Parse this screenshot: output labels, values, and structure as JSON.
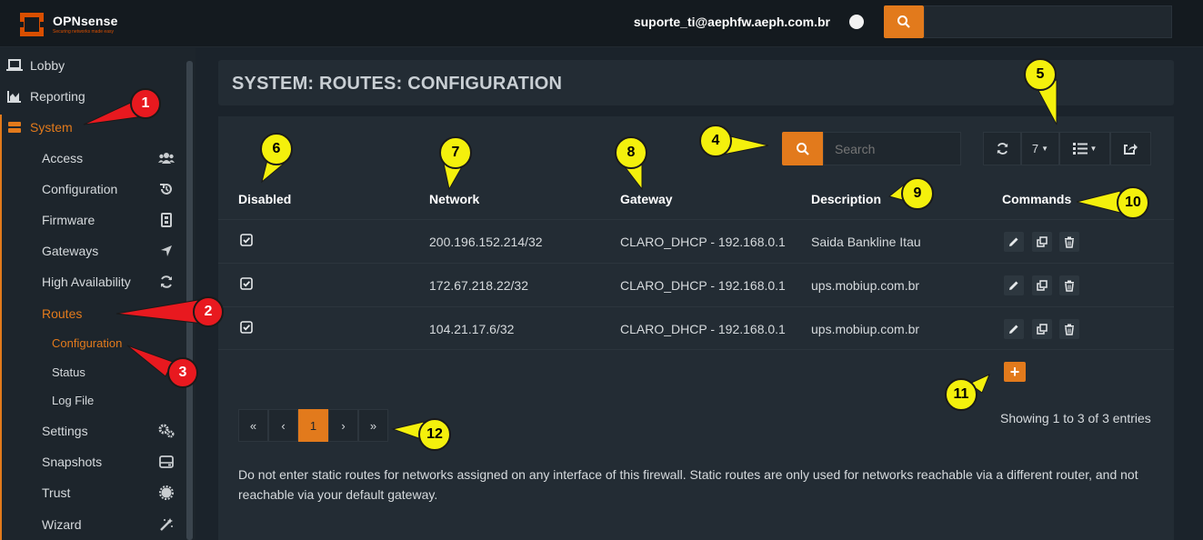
{
  "header": {
    "brand": "OPNsense",
    "tagline": "Securing networks made easy",
    "user": "suporte_ti@aephfw.aeph.com.br"
  },
  "sidebar": {
    "items": [
      {
        "label": "Lobby",
        "icon": "laptop-icon"
      },
      {
        "label": "Reporting",
        "icon": "area-chart-icon"
      },
      {
        "label": "System",
        "icon": "server-icon"
      }
    ],
    "system_sub": [
      {
        "label": "Access",
        "icon": "users-icon"
      },
      {
        "label": "Configuration",
        "icon": "history-icon"
      },
      {
        "label": "Firmware",
        "icon": "microchip-icon"
      },
      {
        "label": "Gateways",
        "icon": "location-arrow-icon"
      },
      {
        "label": "High Availability",
        "icon": "refresh-icon"
      },
      {
        "label": "Routes",
        "icon": ""
      },
      {
        "label": "Settings",
        "icon": "cogs-icon"
      },
      {
        "label": "Snapshots",
        "icon": "hdd-icon"
      },
      {
        "label": "Trust",
        "icon": "certificate-icon"
      },
      {
        "label": "Wizard",
        "icon": "magic-icon"
      }
    ],
    "routes_sub": [
      {
        "label": "Configuration"
      },
      {
        "label": "Status"
      },
      {
        "label": "Log File"
      }
    ]
  },
  "page": {
    "title": "SYSTEM: ROUTES: CONFIGURATION",
    "search_placeholder": "Search",
    "page_size": "7",
    "columns": [
      "Disabled",
      "Network",
      "Gateway",
      "Description",
      "Commands"
    ],
    "rows": [
      {
        "disabled": true,
        "network": "200.196.152.214/32",
        "gateway": "CLARO_DHCP - 192.168.0.1",
        "description": "Saida Bankline Itau"
      },
      {
        "disabled": true,
        "network": "172.67.218.22/32",
        "gateway": "CLARO_DHCP - 192.168.0.1",
        "description": "ups.mobiup.com.br"
      },
      {
        "disabled": true,
        "network": "104.21.17.6/32",
        "gateway": "CLARO_DHCP - 192.168.0.1",
        "description": "ups.mobiup.com.br"
      }
    ],
    "add_label": "+",
    "pagination": {
      "first": "«",
      "prev": "‹",
      "current": "1",
      "next": "›",
      "last": "»"
    },
    "showing": "Showing 1 to 3 of 3 entries",
    "note": "Do not enter static routes for networks assigned on any interface of this firewall. Static routes are only used for networks reachable via a different router, and not reachable via your default gateway."
  },
  "annotations": [
    "1",
    "2",
    "3",
    "4",
    "5",
    "6",
    "7",
    "8",
    "9",
    "10",
    "11",
    "12"
  ],
  "colors": {
    "accent": "#e27a1c",
    "annotation_red": "#e8191f",
    "annotation_yellow": "#f4f00c"
  }
}
